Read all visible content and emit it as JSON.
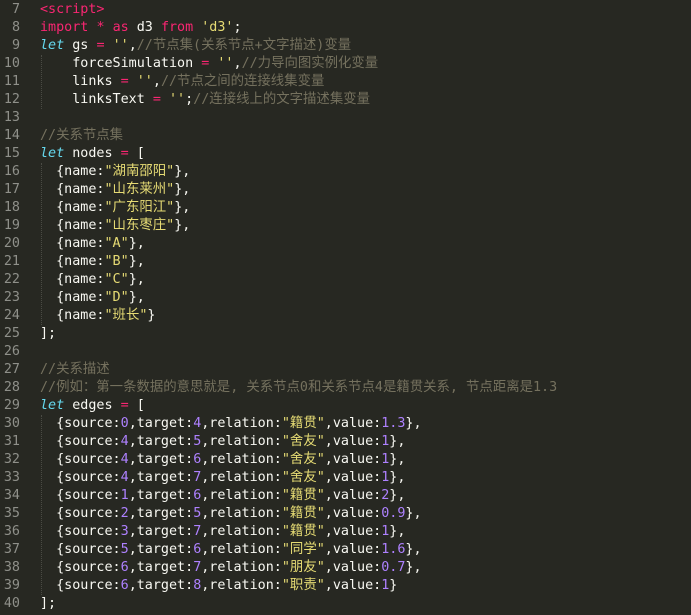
{
  "editor": {
    "lines": [
      {
        "n": "7",
        "segs": [
          {
            "c": "tag",
            "t": "<script>"
          }
        ]
      },
      {
        "n": "8",
        "segs": [
          {
            "c": "kw",
            "t": "import"
          },
          {
            "c": "",
            "t": " "
          },
          {
            "c": "op",
            "t": "*"
          },
          {
            "c": "",
            "t": " "
          },
          {
            "c": "kw",
            "t": "as"
          },
          {
            "c": "",
            "t": " d3 "
          },
          {
            "c": "kw",
            "t": "from"
          },
          {
            "c": "",
            "t": " "
          },
          {
            "c": "str",
            "t": "'d3'"
          },
          {
            "c": "",
            "t": ";"
          }
        ]
      },
      {
        "n": "9",
        "segs": [
          {
            "c": "st",
            "t": "let"
          },
          {
            "c": "",
            "t": " gs "
          },
          {
            "c": "op",
            "t": "="
          },
          {
            "c": "",
            "t": " "
          },
          {
            "c": "str",
            "t": "''"
          },
          {
            "c": "",
            "t": ","
          },
          {
            "c": "cm",
            "t": "//节点集(关系节点+文字描述)变量"
          }
        ]
      },
      {
        "n": "10",
        "segs": [
          {
            "c": "",
            "t": "    forceSimulation "
          },
          {
            "c": "op",
            "t": "="
          },
          {
            "c": "",
            "t": " "
          },
          {
            "c": "str",
            "t": "''"
          },
          {
            "c": "",
            "t": ","
          },
          {
            "c": "cm",
            "t": "//力导向图实例化变量"
          }
        ]
      },
      {
        "n": "11",
        "segs": [
          {
            "c": "",
            "t": "    links "
          },
          {
            "c": "op",
            "t": "="
          },
          {
            "c": "",
            "t": " "
          },
          {
            "c": "str",
            "t": "''"
          },
          {
            "c": "",
            "t": ","
          },
          {
            "c": "cm",
            "t": "//节点之间的连接线集变量"
          }
        ]
      },
      {
        "n": "12",
        "segs": [
          {
            "c": "",
            "t": "    linksText "
          },
          {
            "c": "op",
            "t": "="
          },
          {
            "c": "",
            "t": " "
          },
          {
            "c": "str",
            "t": "''"
          },
          {
            "c": "",
            "t": ";"
          },
          {
            "c": "cm",
            "t": "//连接线上的文字描述集变量"
          }
        ]
      },
      {
        "n": "13",
        "segs": []
      },
      {
        "n": "14",
        "segs": [
          {
            "c": "cm",
            "t": "//关系节点集"
          }
        ]
      },
      {
        "n": "15",
        "segs": [
          {
            "c": "st",
            "t": "let"
          },
          {
            "c": "",
            "t": " nodes "
          },
          {
            "c": "op",
            "t": "="
          },
          {
            "c": "",
            "t": " ["
          }
        ]
      },
      {
        "n": "16",
        "segs": [
          {
            "c": "",
            "t": "  {name:"
          },
          {
            "c": "str",
            "t": "\"湖南邵阳\""
          },
          {
            "c": "",
            "t": "},"
          }
        ]
      },
      {
        "n": "17",
        "segs": [
          {
            "c": "",
            "t": "  {name:"
          },
          {
            "c": "str",
            "t": "\"山东莱州\""
          },
          {
            "c": "",
            "t": "},"
          }
        ]
      },
      {
        "n": "18",
        "segs": [
          {
            "c": "",
            "t": "  {name:"
          },
          {
            "c": "str",
            "t": "\"广东阳江\""
          },
          {
            "c": "",
            "t": "},"
          }
        ]
      },
      {
        "n": "19",
        "segs": [
          {
            "c": "",
            "t": "  {name:"
          },
          {
            "c": "str",
            "t": "\"山东枣庄\""
          },
          {
            "c": "",
            "t": "},"
          }
        ]
      },
      {
        "n": "20",
        "segs": [
          {
            "c": "",
            "t": "  {name:"
          },
          {
            "c": "str",
            "t": "\"A\""
          },
          {
            "c": "",
            "t": "},"
          }
        ]
      },
      {
        "n": "21",
        "segs": [
          {
            "c": "",
            "t": "  {name:"
          },
          {
            "c": "str",
            "t": "\"B\""
          },
          {
            "c": "",
            "t": "},"
          }
        ]
      },
      {
        "n": "22",
        "segs": [
          {
            "c": "",
            "t": "  {name:"
          },
          {
            "c": "str",
            "t": "\"C\""
          },
          {
            "c": "",
            "t": "},"
          }
        ]
      },
      {
        "n": "23",
        "segs": [
          {
            "c": "",
            "t": "  {name:"
          },
          {
            "c": "str",
            "t": "\"D\""
          },
          {
            "c": "",
            "t": "},"
          }
        ]
      },
      {
        "n": "24",
        "segs": [
          {
            "c": "",
            "t": "  {name:"
          },
          {
            "c": "str",
            "t": "\"班长\""
          },
          {
            "c": "",
            "t": "}"
          }
        ]
      },
      {
        "n": "25",
        "segs": [
          {
            "c": "",
            "t": "];"
          }
        ]
      },
      {
        "n": "26",
        "segs": []
      },
      {
        "n": "27",
        "segs": [
          {
            "c": "cm",
            "t": "//关系描述"
          }
        ]
      },
      {
        "n": "28",
        "segs": [
          {
            "c": "cm",
            "t": "//例如：第一条数据的意思就是, 关系节点0和关系节点4是籍贯关系, 节点距离是1.3"
          }
        ]
      },
      {
        "n": "29",
        "segs": [
          {
            "c": "st",
            "t": "let"
          },
          {
            "c": "",
            "t": " edges "
          },
          {
            "c": "op",
            "t": "="
          },
          {
            "c": "",
            "t": " ["
          }
        ]
      },
      {
        "n": "30",
        "segs": [
          {
            "c": "",
            "t": "  {source:"
          },
          {
            "c": "num",
            "t": "0"
          },
          {
            "c": "",
            "t": ",target:"
          },
          {
            "c": "num",
            "t": "4"
          },
          {
            "c": "",
            "t": ",relation:"
          },
          {
            "c": "str",
            "t": "\"籍贯\""
          },
          {
            "c": "",
            "t": ",value:"
          },
          {
            "c": "num",
            "t": "1.3"
          },
          {
            "c": "",
            "t": "},"
          }
        ]
      },
      {
        "n": "31",
        "segs": [
          {
            "c": "",
            "t": "  {source:"
          },
          {
            "c": "num",
            "t": "4"
          },
          {
            "c": "",
            "t": ",target:"
          },
          {
            "c": "num",
            "t": "5"
          },
          {
            "c": "",
            "t": ",relation:"
          },
          {
            "c": "str",
            "t": "\"舍友\""
          },
          {
            "c": "",
            "t": ",value:"
          },
          {
            "c": "num",
            "t": "1"
          },
          {
            "c": "",
            "t": "},"
          }
        ]
      },
      {
        "n": "32",
        "segs": [
          {
            "c": "",
            "t": "  {source:"
          },
          {
            "c": "num",
            "t": "4"
          },
          {
            "c": "",
            "t": ",target:"
          },
          {
            "c": "num",
            "t": "6"
          },
          {
            "c": "",
            "t": ",relation:"
          },
          {
            "c": "str",
            "t": "\"舍友\""
          },
          {
            "c": "",
            "t": ",value:"
          },
          {
            "c": "num",
            "t": "1"
          },
          {
            "c": "",
            "t": "},"
          }
        ]
      },
      {
        "n": "33",
        "segs": [
          {
            "c": "",
            "t": "  {source:"
          },
          {
            "c": "num",
            "t": "4"
          },
          {
            "c": "",
            "t": ",target:"
          },
          {
            "c": "num",
            "t": "7"
          },
          {
            "c": "",
            "t": ",relation:"
          },
          {
            "c": "str",
            "t": "\"舍友\""
          },
          {
            "c": "",
            "t": ",value:"
          },
          {
            "c": "num",
            "t": "1"
          },
          {
            "c": "",
            "t": "},"
          }
        ]
      },
      {
        "n": "34",
        "segs": [
          {
            "c": "",
            "t": "  {source:"
          },
          {
            "c": "num",
            "t": "1"
          },
          {
            "c": "",
            "t": ",target:"
          },
          {
            "c": "num",
            "t": "6"
          },
          {
            "c": "",
            "t": ",relation:"
          },
          {
            "c": "str",
            "t": "\"籍贯\""
          },
          {
            "c": "",
            "t": ",value:"
          },
          {
            "c": "num",
            "t": "2"
          },
          {
            "c": "",
            "t": "},"
          }
        ]
      },
      {
        "n": "35",
        "segs": [
          {
            "c": "",
            "t": "  {source:"
          },
          {
            "c": "num",
            "t": "2"
          },
          {
            "c": "",
            "t": ",target:"
          },
          {
            "c": "num",
            "t": "5"
          },
          {
            "c": "",
            "t": ",relation:"
          },
          {
            "c": "str",
            "t": "\"籍贯\""
          },
          {
            "c": "",
            "t": ",value:"
          },
          {
            "c": "num",
            "t": "0.9"
          },
          {
            "c": "",
            "t": "},"
          }
        ]
      },
      {
        "n": "36",
        "segs": [
          {
            "c": "",
            "t": "  {source:"
          },
          {
            "c": "num",
            "t": "3"
          },
          {
            "c": "",
            "t": ",target:"
          },
          {
            "c": "num",
            "t": "7"
          },
          {
            "c": "",
            "t": ",relation:"
          },
          {
            "c": "str",
            "t": "\"籍贯\""
          },
          {
            "c": "",
            "t": ",value:"
          },
          {
            "c": "num",
            "t": "1"
          },
          {
            "c": "",
            "t": "},"
          }
        ]
      },
      {
        "n": "37",
        "segs": [
          {
            "c": "",
            "t": "  {source:"
          },
          {
            "c": "num",
            "t": "5"
          },
          {
            "c": "",
            "t": ",target:"
          },
          {
            "c": "num",
            "t": "6"
          },
          {
            "c": "",
            "t": ",relation:"
          },
          {
            "c": "str",
            "t": "\"同学\""
          },
          {
            "c": "",
            "t": ",value:"
          },
          {
            "c": "num",
            "t": "1.6"
          },
          {
            "c": "",
            "t": "},"
          }
        ]
      },
      {
        "n": "38",
        "segs": [
          {
            "c": "",
            "t": "  {source:"
          },
          {
            "c": "num",
            "t": "6"
          },
          {
            "c": "",
            "t": ",target:"
          },
          {
            "c": "num",
            "t": "7"
          },
          {
            "c": "",
            "t": ",relation:"
          },
          {
            "c": "str",
            "t": "\"朋友\""
          },
          {
            "c": "",
            "t": ",value:"
          },
          {
            "c": "num",
            "t": "0.7"
          },
          {
            "c": "",
            "t": "},"
          }
        ]
      },
      {
        "n": "39",
        "segs": [
          {
            "c": "",
            "t": "  {source:"
          },
          {
            "c": "num",
            "t": "6"
          },
          {
            "c": "",
            "t": ",target:"
          },
          {
            "c": "num",
            "t": "8"
          },
          {
            "c": "",
            "t": ",relation:"
          },
          {
            "c": "str",
            "t": "\"职责\""
          },
          {
            "c": "",
            "t": ",value:"
          },
          {
            "c": "num",
            "t": "1"
          },
          {
            "c": "",
            "t": "}"
          }
        ]
      },
      {
        "n": "40",
        "segs": [
          {
            "c": "",
            "t": "];"
          }
        ]
      }
    ]
  },
  "theme": {
    "background": "#272822",
    "foreground": "#f8f8f2",
    "keyword": "#f92672",
    "storage": "#66d9ef",
    "string": "#e6db74",
    "comment": "#75715e",
    "number": "#ae81ff",
    "gutter": "#8f908a"
  }
}
